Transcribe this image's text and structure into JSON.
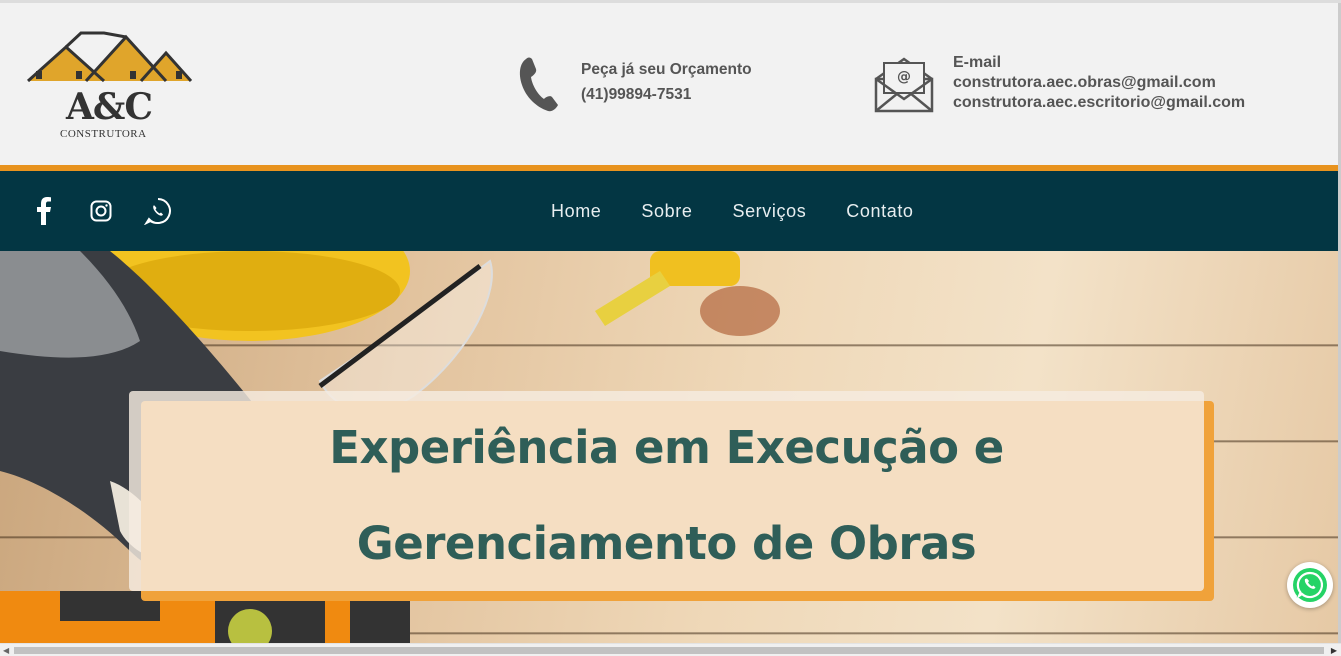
{
  "brand": {
    "logo_main": "A&C",
    "logo_sub": "CONSTRUTORA"
  },
  "contact": {
    "phone_title": "Peça já seu Orçamento",
    "phone_number": "(41)99894-7531",
    "email_title": "E-mail",
    "email_1": "construtora.aec.obras@gmail.com",
    "email_2": "construtora.aec.escritorio@gmail.com"
  },
  "social": [
    "facebook-icon",
    "instagram-icon",
    "whatsapp-icon"
  ],
  "nav": {
    "items": [
      {
        "label": "Home"
      },
      {
        "label": "Sobre"
      },
      {
        "label": "Serviços"
      },
      {
        "label": "Contato"
      }
    ]
  },
  "hero": {
    "line1": "Experiência em Execução e",
    "line2": "Gerenciamento de Obras"
  },
  "colors": {
    "nav_bg": "#033643",
    "accent": "#e8931e",
    "hero_text": "#2f5e58",
    "whatsapp": "#25d366"
  }
}
